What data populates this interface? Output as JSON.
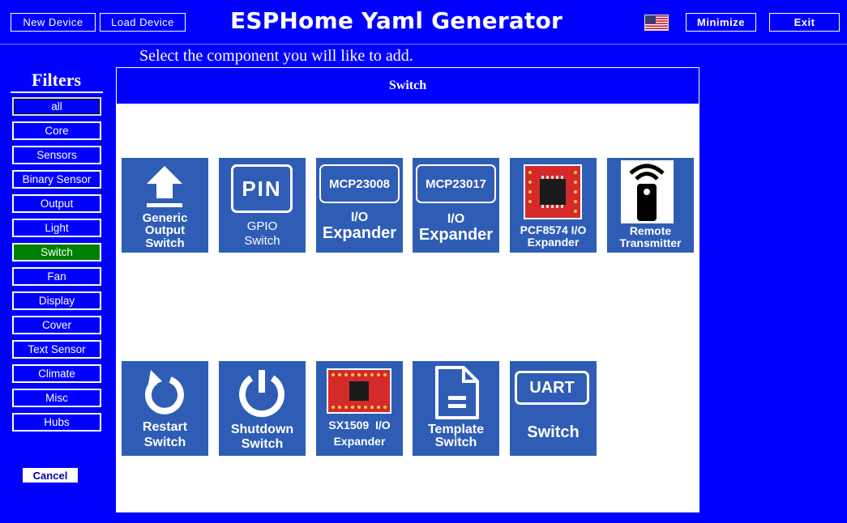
{
  "header": {
    "new_device": "New Device",
    "load_device": "Load Device",
    "title": "ESPHome Yaml Generator",
    "minimize": "Minimize",
    "exit": "Exit"
  },
  "prompt": "Select the component you will like to add.",
  "sidebar": {
    "title": "Filters",
    "items": [
      "all",
      "Core",
      "Sensors",
      "Binary Sensor",
      "Output",
      "Light",
      "Switch",
      "Fan",
      "Display",
      "Cover",
      "Text Sensor",
      "Climate",
      "Misc",
      "Hubs"
    ],
    "selected": "Switch",
    "cancel": "Cancel"
  },
  "panel": {
    "title": "Switch",
    "tiles": [
      {
        "name": "generic-output-switch",
        "icon": "upload-arrow-icon",
        "line1": "Generic",
        "line2": "Output",
        "line3": "Switch"
      },
      {
        "name": "gpio-switch",
        "icon": "pin-icon",
        "chip": "PIN",
        "line1": "GPIO",
        "line2": "Switch"
      },
      {
        "name": "mcp23008-io-expander",
        "icon": "mcp-chip-icon",
        "chip": "MCP23008",
        "line1": "I/O",
        "line2": "Expander"
      },
      {
        "name": "mcp23017-io-expander",
        "icon": "mcp-chip-icon",
        "chip": "MCP23017",
        "line1": "I/O",
        "line2": "Expander"
      },
      {
        "name": "pcf8574-io-expander",
        "icon": "pcb-board-icon",
        "line1": "PCF8574 I/O",
        "line2": "Expander"
      },
      {
        "name": "remote-transmitter",
        "icon": "remote-control-icon",
        "line1": "Remote",
        "line2": "Transmitter"
      },
      {
        "name": "restart-switch",
        "icon": "restart-icon",
        "line1": "Restart",
        "line2": "Switch"
      },
      {
        "name": "shutdown-switch",
        "icon": "power-icon",
        "line1": "Shutdown",
        "line2": "Switch"
      },
      {
        "name": "sx1509-io-expander",
        "icon": "pcb-board-icon",
        "line1": "SX1509  I/O",
        "line2": "Expander"
      },
      {
        "name": "template-switch",
        "icon": "document-icon",
        "line1": "Template",
        "line2": "Switch"
      },
      {
        "name": "uart-switch",
        "icon": "uart-chip-icon",
        "chip": "UART",
        "line1": "Switch"
      }
    ]
  },
  "colors": {
    "background": "#0000ff",
    "tile": "#2f5db6",
    "selected_filter": "#008000"
  }
}
